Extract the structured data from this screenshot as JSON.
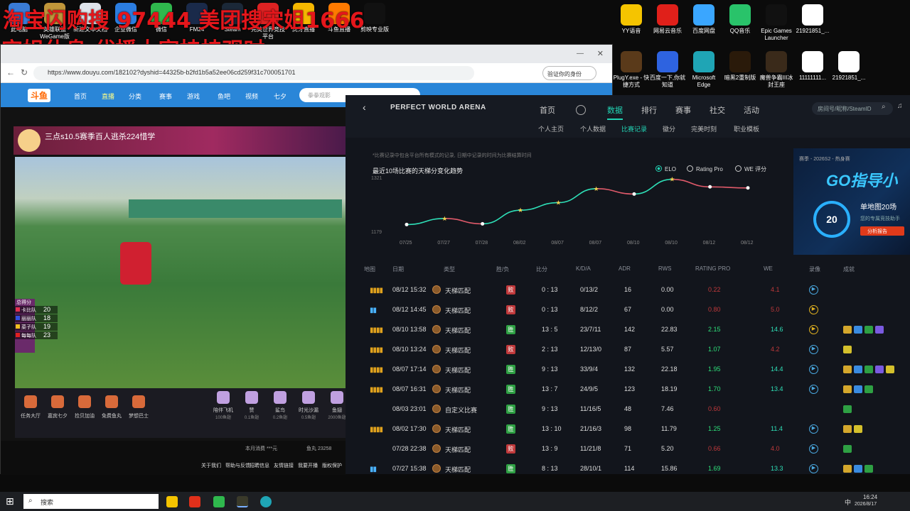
{
  "overlay_text": {
    "line1": "淘宝闪购搜 97444 美团搜宋姐1666",
    "line2": "宋姐休息 代播大家挂挂观时"
  },
  "desktop_icons_left": [
    {
      "label": "此电脑",
      "color": "#3a7bd5"
    },
    {
      "label": "英雄联盟 WeGame版",
      "color": "#c0963a"
    },
    {
      "label": "新建文本文档",
      "color": "#dfe3ea"
    },
    {
      "label": "企业微信",
      "color": "#2b7de0"
    },
    {
      "label": "微信",
      "color": "#2fb84d"
    },
    {
      "label": "FM24",
      "color": "#1a2a4a"
    },
    {
      "label": "Steam",
      "color": "#1b2838"
    },
    {
      "label": "完美世界竞技平台",
      "color": "#d22"
    },
    {
      "label": "虎牙直播",
      "color": "#f5b700"
    },
    {
      "label": "斗鱼直播",
      "color": "#ff7a00"
    },
    {
      "label": "剪映专业版",
      "color": "#111"
    }
  ],
  "desktop_icons_right_row1": [
    {
      "label": "YY语音",
      "color": "#f5c400"
    },
    {
      "label": "网易云音乐",
      "color": "#e0201a"
    },
    {
      "label": "百度网盘",
      "color": "#3aa6ff"
    },
    {
      "label": "QQ音乐",
      "color": "#29c36a"
    },
    {
      "label": "Epic Games Launcher",
      "color": "#111"
    },
    {
      "label": "21921851_...",
      "color": "#fff"
    }
  ],
  "desktop_icons_right_row2": [
    {
      "label": "PlugY.exe - 快捷方式",
      "color": "#5a3a1a"
    },
    {
      "label": "百度一下,你就知道",
      "color": "#2e63e0"
    },
    {
      "label": "Microsoft Edge",
      "color": "#1fa5b5"
    },
    {
      "label": "暗黑2重制版",
      "color": "#2a1a0a"
    },
    {
      "label": "魔兽争霸III冰封王座",
      "color": "#3a2a1a"
    },
    {
      "label": "11111111...",
      "color": "#fff"
    },
    {
      "label": "21921851_...",
      "color": "#fff"
    }
  ],
  "browser": {
    "url": "https://www.douyu.com/182102?dyshid=44325b-b2fd1b5a52ee06cd259f31c700051701",
    "account": "验证你的身份",
    "nav": [
      "首页",
      "直播",
      "分类",
      "赛事",
      "游戏",
      "鱼吧",
      "视频",
      "七夕"
    ],
    "search_placeholder": "拳拳观影",
    "stream_title": "三点s10.5赛季百人逃杀224惜学",
    "scoreboard_title": "总得分",
    "scoreboard": [
      {
        "team": "卡比队",
        "score": "20",
        "color": "#e03050"
      },
      {
        "team": "丽丽队",
        "score": "18",
        "color": "#3050e0"
      },
      {
        "team": "菜子队",
        "score": "19",
        "color": "#f0c020"
      },
      {
        "team": "每每队",
        "score": "23",
        "color": "#e02020"
      }
    ],
    "gifts": [
      "任务大厅",
      "嘉宾七夕",
      "捡贝加油",
      "免费鱼丸",
      "梦想巴士"
    ],
    "gifts_right": [
      "陪伴飞机",
      "赞",
      "鲨鸟",
      "时光沙漏",
      "鱼翅"
    ],
    "gift_prices": [
      "100鱼翅",
      "0.1鱼翅",
      "0.2鱼翅",
      "0.5鱼翅",
      "2000鱼翅"
    ],
    "consume": "本月消费 ***元",
    "fishball": "鱼丸 23258",
    "footer_links": [
      "关于我们",
      "帮助与反馈",
      "招聘信息",
      "友情链接",
      "我要开播",
      "版权保护"
    ]
  },
  "pwa": {
    "brand": "PERFECT WORLD ARENA",
    "nav": [
      "首页",
      "数据",
      "排行",
      "赛事",
      "社交",
      "活动"
    ],
    "active_nav": "数据",
    "search_placeholder": "房间号/昵称/SteamID",
    "subnav": [
      "个人主页",
      "个人数据",
      "比赛记录",
      "徽分",
      "完美时刻",
      "职业模板"
    ],
    "active_subnav": "比赛记录",
    "note": "*比赛记录中包含平台所有模式的记录, 日期中记录的时间为比赛结算时间",
    "chart_title": "最近10场比赛的天梯分变化趋势",
    "radio": [
      {
        "label": "ELO",
        "checked": true
      },
      {
        "label": "Rating Pro",
        "checked": false
      },
      {
        "label": "WE 评分",
        "checked": false
      }
    ],
    "banner": {
      "season": "赛季 - 2026S2 - 热身赛",
      "title": "GO指导小",
      "circle": "20",
      "subtitle": "单地图20场",
      "desc": "您的专属竞技助手",
      "button": "分析报告"
    },
    "table_headers": [
      "地图",
      "日期",
      "类型",
      "胜/负",
      "比分",
      "K/D/A",
      "ADR",
      "RWS",
      "RATING PRO",
      "WE",
      "录像",
      "成就"
    ],
    "rows": [
      {
        "date": "08/12 15:32",
        "type": "天梯匹配",
        "result": "败",
        "score": "0 : 13",
        "kda": "0/13/2",
        "adr": "16",
        "rws": "0.00",
        "rating": "0.22",
        "we": "4.1",
        "bars": "yellow",
        "demo": "blue",
        "tags": []
      },
      {
        "date": "08/12 14:45",
        "type": "天梯匹配",
        "result": "败",
        "score": "0 : 13",
        "kda": "8/12/2",
        "adr": "67",
        "rws": "0.00",
        "rating": "0.80",
        "we": "5.0",
        "bars": "blue",
        "demo": "yellow",
        "tags": []
      },
      {
        "date": "08/10 13:58",
        "type": "天梯匹配",
        "result": "胜",
        "score": "13 : 5",
        "kda": "23/7/11",
        "adr": "142",
        "rws": "22.83",
        "rating": "2.15",
        "we": "14.6",
        "bars": "yellow",
        "demo": "yellow",
        "tags": [
          "#d4a72c",
          "#3a8be0",
          "#2ea043",
          "#7a5ae0"
        ]
      },
      {
        "date": "08/10 13:24",
        "type": "天梯匹配",
        "result": "败",
        "score": "2 : 13",
        "kda": "12/13/0",
        "adr": "87",
        "rws": "5.57",
        "rating": "1.07",
        "we": "4.2",
        "bars": "yellow",
        "demo": "blue",
        "tags": [
          "#d4c02c"
        ]
      },
      {
        "date": "08/07 17:14",
        "type": "天梯匹配",
        "result": "胜",
        "score": "9 : 13",
        "kda": "33/9/4",
        "adr": "132",
        "rws": "22.18",
        "rating": "1.95",
        "we": "14.4",
        "bars": "yellow",
        "demo": "blue",
        "tags": [
          "#d4a72c",
          "#3a8be0",
          "#2ea043",
          "#7a5ae0",
          "#d4c02c"
        ]
      },
      {
        "date": "08/07 16:31",
        "type": "天梯匹配",
        "result": "胜",
        "score": "13 : 7",
        "kda": "24/9/5",
        "adr": "123",
        "rws": "18.19",
        "rating": "1.70",
        "we": "13.4",
        "bars": "yellow",
        "demo": "blue",
        "tags": [
          "#d4a72c",
          "#3a8be0",
          "#2ea043"
        ]
      },
      {
        "date": "08/03 23:01",
        "type": "自定义比赛",
        "result": "胜",
        "score": "9 : 13",
        "kda": "11/16/5",
        "adr": "48",
        "rws": "7.46",
        "rating": "0.60",
        "we": "",
        "bars": "",
        "demo": "",
        "tags": [
          "#2ea043"
        ]
      },
      {
        "date": "08/02 17:30",
        "type": "天梯匹配",
        "result": "胜",
        "score": "13 : 10",
        "kda": "21/16/3",
        "adr": "98",
        "rws": "11.79",
        "rating": "1.25",
        "we": "11.4",
        "bars": "yellow",
        "demo": "blue",
        "tags": [
          "#d4a72c",
          "#d4c02c"
        ]
      },
      {
        "date": "07/28 22:38",
        "type": "天梯匹配",
        "result": "败",
        "score": "13 : 9",
        "kda": "11/21/8",
        "adr": "71",
        "rws": "5.20",
        "rating": "0.66",
        "we": "4.0",
        "bars": "",
        "demo": "blue",
        "tags": [
          "#2ea043"
        ]
      },
      {
        "date": "07/27 15:38",
        "type": "天梯匹配",
        "result": "胜",
        "score": "8 : 13",
        "kda": "28/10/1",
        "adr": "114",
        "rws": "15.86",
        "rating": "1.69",
        "we": "13.3",
        "bars": "blue",
        "demo": "blue",
        "tags": [
          "#d4a72c",
          "#3a8be0",
          "#2ea043"
        ]
      }
    ]
  },
  "chart_data": {
    "type": "line",
    "title": "最近10场比赛的天梯分变化趋势",
    "categories": [
      "07/25",
      "07/27",
      "07/28",
      "08/02",
      "08/07",
      "08/07",
      "08/10",
      "08/10",
      "08/12",
      "08/12"
    ],
    "y_top_label": "1321",
    "y_bottom_label": "1179",
    "values": [
      1179,
      1196,
      1181,
      1219,
      1240,
      1279,
      1264,
      1305,
      1284,
      1281
    ],
    "ylim": [
      1160,
      1330
    ],
    "grid": false,
    "colors": {
      "up": "#2ee0b8",
      "down": "#e05a6a",
      "point": "#ffffff",
      "star": "#f0d050"
    }
  },
  "taskbar": {
    "search": "搜索",
    "time": "16:24",
    "date": "2026/8/17",
    "ime": "中"
  },
  "colors": {
    "accent": "#22d3b4",
    "lose": "#c0393b",
    "win": "#2ea043"
  }
}
